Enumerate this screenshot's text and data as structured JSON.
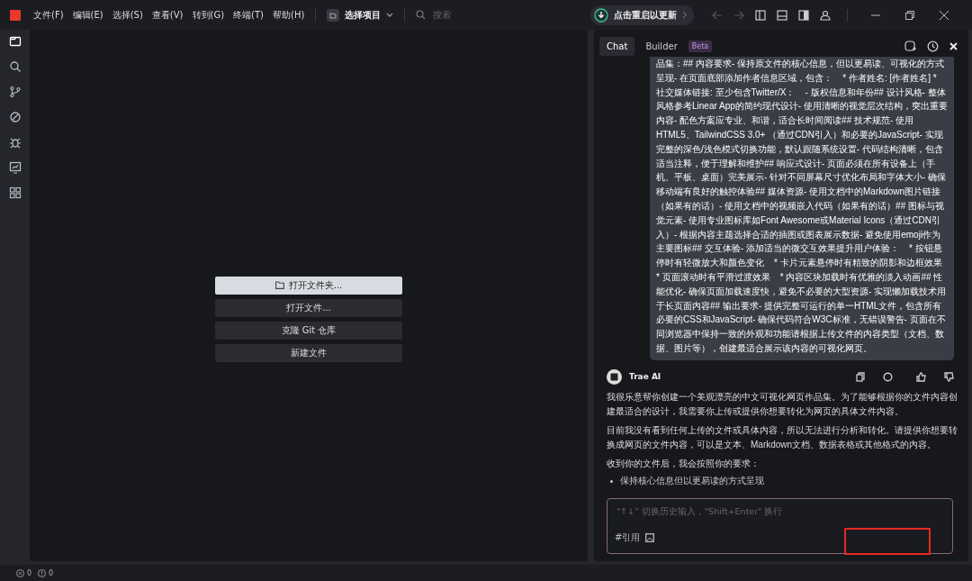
{
  "menu": [
    {
      "label": "文件(F)"
    },
    {
      "label": "编辑(E)"
    },
    {
      "label": "选择(S)"
    },
    {
      "label": "查看(V)"
    },
    {
      "label": "转到(G)"
    },
    {
      "label": "终端(T)"
    },
    {
      "label": "帮助(H)"
    }
  ],
  "project_picker": {
    "label": "选择项目"
  },
  "search": {
    "placeholder": "搜索"
  },
  "update_button": {
    "label": "点击重启以更新"
  },
  "activity_bar": [
    {
      "kind": "files",
      "selected": true
    },
    {
      "kind": "search",
      "selected": false
    },
    {
      "kind": "git",
      "selected": false
    },
    {
      "kind": "remote",
      "selected": false
    },
    {
      "kind": "debug",
      "selected": false
    },
    {
      "kind": "preview",
      "selected": false
    },
    {
      "kind": "extensions",
      "selected": false
    }
  ],
  "start_actions": [
    {
      "label": "打开文件夹...",
      "icon": true,
      "selected": true
    },
    {
      "label": "打开文件...",
      "icon": false,
      "selected": false
    },
    {
      "label": "克隆 Git 仓库",
      "icon": false,
      "selected": false
    },
    {
      "label": "新建文件",
      "icon": false,
      "selected": false
    }
  ],
  "chat_tabs": [
    {
      "label": "Chat",
      "selected": true
    },
    {
      "label": "Builder",
      "badge": "Beta",
      "selected": false
    }
  ],
  "user_message": "品集：## 内容要求- 保持原文件的核心信息，但以更易读、可视化的方式呈现- 在页面底部添加作者信息区域，包含：    * 作者姓名: [作者姓名] * 社交媒体链接: 至少包含Twitter/X：    - 版权信息和年份## 设计风格- 整体风格参考Linear App的简约现代设计- 使用清晰的视觉层次结构，突出重要内容- 配色方案应专业、和谐，适合长时间阅读## 技术规范- 使用HTML5、TailwindCSS 3.0+ （通过CDN引入）和必要的JavaScript- 实现完整的深色/浅色模式切换功能，默认跟随系统设置- 代码结构清晰，包含适当注释，便于理解和维护## 响应式设计- 页面必须在所有设备上（手机、平板、桌面）完美展示- 针对不同屏幕尺寸优化布局和字体大小- 确保移动端有良好的触控体验## 媒体资源- 使用文档中的Markdown图片链接（如果有的话）- 使用文档中的视频嵌入代码（如果有的话）## 图标与视觉元素- 使用专业图标库如Font Awesome或Material Icons（通过CDN引入）- 根据内容主题选择合适的插图或图表展示数据- 避免使用emoji作为主要图标## 交互体验- 添加适当的微交互效果提升用户体验：    * 按钮悬停时有轻微放大和颜色变化    * 卡片元素悬停时有精致的阴影和边框效果    * 页面滚动时有平滑过渡效果    * 内容区块加载时有优雅的淡入动画## 性能优化- 确保页面加载速度快，避免不必要的大型资源- 实现懒加载技术用于长页面内容## 输出要求- 提供完整可运行的单一HTML文件，包含所有必要的CSS和JavaScript- 确保代码符合W3C标准，无错误警告- 页面在不同浏览器中保持一致的外观和功能请根据上传文件的内容类型（文档、数据、图片等），创建最适合展示该内容的可视化网页。",
  "assistant": {
    "name": "Trae AI",
    "paragraphs": [
      "我很乐意帮你创建一个美观漂亮的中文可视化网页作品集。为了能够根据你的文件内容创建最适合的设计，我需要你上传或提供你想要转化为网页的具体文件内容。",
      "目前我没有看到任何上传的文件或具体内容，所以无法进行分析和转化。请提供你想要转换成网页的文件内容，可以是文本、Markdown文档、数据表格或其他格式的内容。",
      "收到你的文件后，我会按照你的要求："
    ],
    "bullets": [
      "保持核心信息但以更易读的方式呈现"
    ]
  },
  "chat_input": {
    "placeholder": "\"↑↓\" 切换历史输入，\"Shift+Enter\" 换行",
    "reference_label": "#引用"
  },
  "status_bar": {
    "errors": "0",
    "warnings": "0"
  }
}
